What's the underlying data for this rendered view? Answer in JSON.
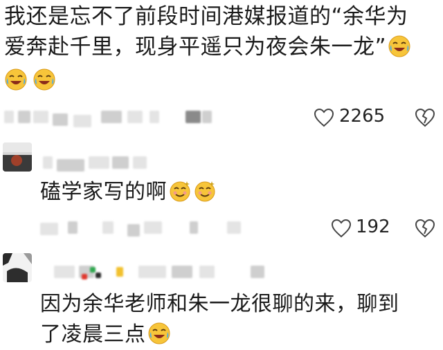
{
  "comment": {
    "text_line1": "我还是忘不了前段时间港媒报道的“余华为",
    "text_line2": "爱奔赴千里，现身平遥只为夜会朱一龙”",
    "like_count": "2265",
    "emojis": [
      "crying-laugh-emoji"
    ]
  },
  "reply1": {
    "text": "磕学家写的啊",
    "like_count": "192",
    "emojis": [
      "dizzy-smile-emoji"
    ]
  },
  "reply2": {
    "text_line1": "因为余华老师和朱一龙很聊的来，聊到",
    "text_line2": "了凌晨三点",
    "emojis": [
      "crying-laugh-emoji"
    ]
  },
  "icons": [
    "heart-icon",
    "dislike-heart-icon"
  ],
  "colors": {
    "text": "#1a1a1a",
    "icon": "#444444",
    "emoji_face": "#f7c53a"
  }
}
